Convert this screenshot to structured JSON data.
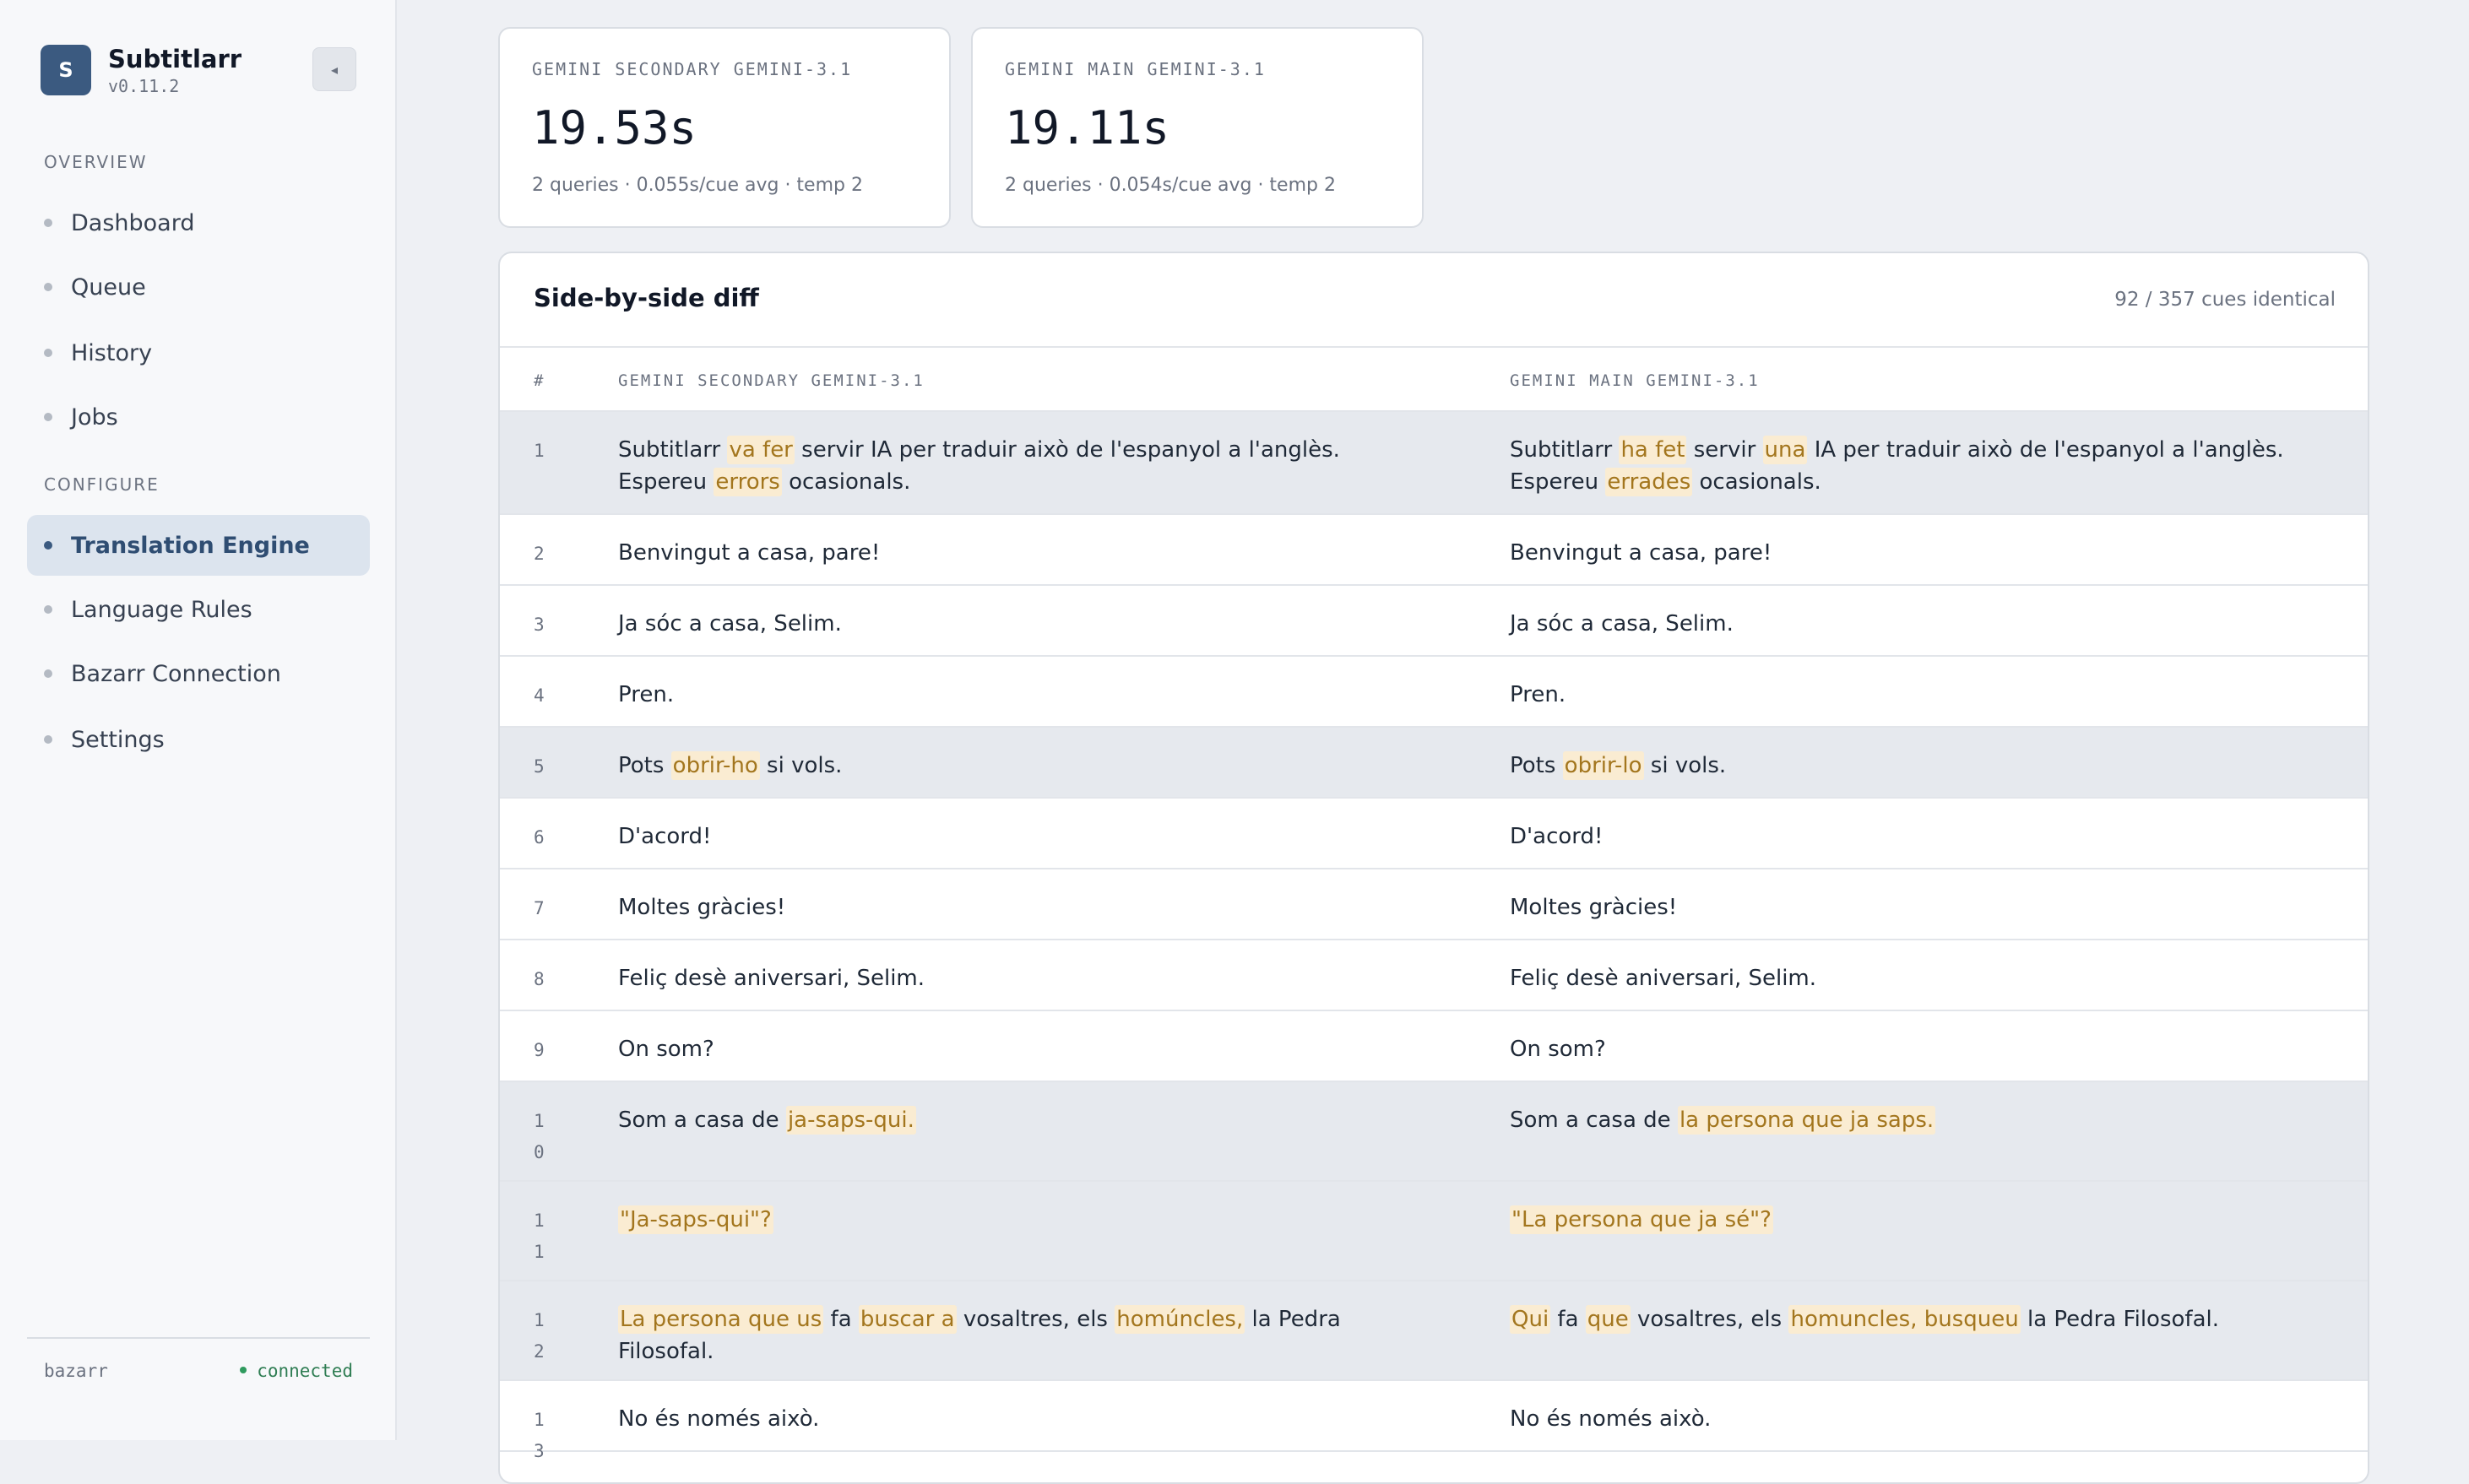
{
  "app": {
    "name": "Subtitlarr",
    "version": "v0.11.2",
    "logo_letter": "S"
  },
  "sidebar": {
    "collapse_icon": "◂",
    "sections": [
      {
        "label": "Overview",
        "items": [
          "Dashboard",
          "Queue",
          "History",
          "Jobs"
        ]
      },
      {
        "label": "Configure",
        "items": [
          "Translation Engine",
          "Language Rules",
          "Bazarr Connection",
          "Settings"
        ]
      }
    ],
    "active_item": "Translation Engine",
    "footer": {
      "service": "bazarr",
      "status": "connected",
      "status_color": "#2f9a5e"
    }
  },
  "stats": [
    {
      "title": "GEMINI SECONDARY GEMINI-3.1",
      "value": "19.53s",
      "sub": "2 queries · 0.055s/cue avg · temp 2"
    },
    {
      "title": "GEMINI MAIN GEMINI-3.1",
      "value": "19.11s",
      "sub": "2 queries · 0.054s/cue avg · temp 2"
    }
  ],
  "diff": {
    "title": "Side-by-side diff",
    "summary": "92 / 357 cues identical",
    "columns": {
      "num": "#",
      "left": "GEMINI SECONDARY GEMINI-3.1",
      "right": "GEMINI MAIN GEMINI-3.1"
    },
    "highlight_color": "#faecd2",
    "rows": [
      {
        "n": "1",
        "changed": true,
        "left": [
          [
            "Subtitlarr ",
            false
          ],
          [
            "va fer",
            true
          ],
          [
            " servir IA per traduir això de l'espanyol a l'anglès. Espereu ",
            false
          ],
          [
            "errors",
            true
          ],
          [
            " ocasionals.",
            false
          ]
        ],
        "right": [
          [
            "Subtitlarr ",
            false
          ],
          [
            "ha fet",
            true
          ],
          [
            " servir ",
            false
          ],
          [
            "una",
            true
          ],
          [
            " IA per traduir això de l'espanyol a l'anglès. Espereu ",
            false
          ],
          [
            "errades",
            true
          ],
          [
            " ocasionals.",
            false
          ]
        ]
      },
      {
        "n": "2",
        "changed": false,
        "left": [
          [
            "Benvingut a casa, pare!",
            false
          ]
        ],
        "right": [
          [
            "Benvingut a casa, pare!",
            false
          ]
        ]
      },
      {
        "n": "3",
        "changed": false,
        "left": [
          [
            "Ja sóc a casa, Selim.",
            false
          ]
        ],
        "right": [
          [
            "Ja sóc a casa, Selim.",
            false
          ]
        ]
      },
      {
        "n": "4",
        "changed": false,
        "left": [
          [
            "Pren.",
            false
          ]
        ],
        "right": [
          [
            "Pren.",
            false
          ]
        ]
      },
      {
        "n": "5",
        "changed": true,
        "left": [
          [
            "Pots ",
            false
          ],
          [
            "obrir-ho",
            true
          ],
          [
            " si vols.",
            false
          ]
        ],
        "right": [
          [
            "Pots ",
            false
          ],
          [
            "obrir-lo",
            true
          ],
          [
            " si vols.",
            false
          ]
        ]
      },
      {
        "n": "6",
        "changed": false,
        "left": [
          [
            "D'acord!",
            false
          ]
        ],
        "right": [
          [
            "D'acord!",
            false
          ]
        ]
      },
      {
        "n": "7",
        "changed": false,
        "left": [
          [
            "Moltes gràcies!",
            false
          ]
        ],
        "right": [
          [
            "Moltes gràcies!",
            false
          ]
        ]
      },
      {
        "n": "8",
        "changed": false,
        "left": [
          [
            "Feliç desè aniversari, Selim.",
            false
          ]
        ],
        "right": [
          [
            "Feliç desè aniversari, Selim.",
            false
          ]
        ]
      },
      {
        "n": "9",
        "changed": false,
        "left": [
          [
            "On som?",
            false
          ]
        ],
        "right": [
          [
            "On som?",
            false
          ]
        ]
      },
      {
        "n": "10",
        "changed": true,
        "left": [
          [
            "Som a casa de ",
            false
          ],
          [
            "ja-saps-qui.",
            true
          ]
        ],
        "right": [
          [
            "Som a casa de ",
            false
          ],
          [
            "la persona que ja saps.",
            true
          ]
        ]
      },
      {
        "n": "11",
        "changed": true,
        "left": [
          [
            "\"Ja-saps-qui\"?",
            true
          ]
        ],
        "right": [
          [
            "\"La persona que ja sé\"?",
            true
          ]
        ]
      },
      {
        "n": "12",
        "changed": true,
        "left": [
          [
            "La persona que us",
            true
          ],
          [
            " fa ",
            false
          ],
          [
            "buscar a",
            true
          ],
          [
            " vosaltres, els ",
            false
          ],
          [
            "homúncles,",
            true
          ],
          [
            " la Pedra Filosofal.",
            false
          ]
        ],
        "right": [
          [
            "Qui",
            true
          ],
          [
            " fa ",
            false
          ],
          [
            "que",
            true
          ],
          [
            " vosaltres, els ",
            false
          ],
          [
            "homuncles, busqueu",
            true
          ],
          [
            " la Pedra Filosofal.",
            false
          ]
        ]
      },
      {
        "n": "13",
        "changed": false,
        "left": [
          [
            "No és només això.",
            false
          ]
        ],
        "right": [
          [
            "No és només això.",
            false
          ]
        ]
      }
    ]
  }
}
